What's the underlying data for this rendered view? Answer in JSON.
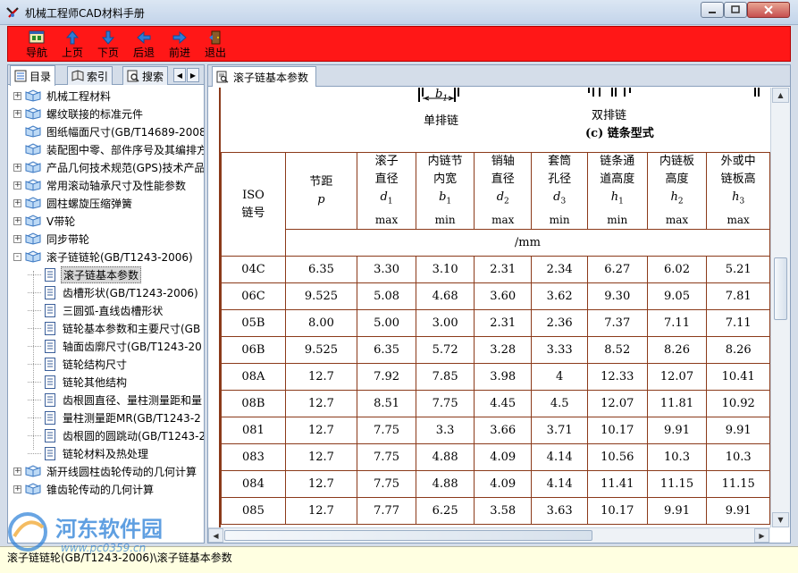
{
  "window": {
    "title": "机械工程师CAD材料手册"
  },
  "toolbar": {
    "buttons": [
      {
        "label": "导航",
        "icon": "navigate-icon"
      },
      {
        "label": "上页",
        "icon": "arrow-up-icon"
      },
      {
        "label": "下页",
        "icon": "arrow-down-icon"
      },
      {
        "label": "后退",
        "icon": "arrow-left-icon"
      },
      {
        "label": "前进",
        "icon": "arrow-right-icon"
      },
      {
        "label": "退出",
        "icon": "exit-door-icon"
      }
    ]
  },
  "left_tabs": [
    "目录",
    "索引",
    "搜索"
  ],
  "tree": [
    {
      "label": "机械工程材料",
      "level": 0,
      "type": "book",
      "expander": "+"
    },
    {
      "label": "螺纹联接的标准元件",
      "level": 0,
      "type": "book",
      "expander": "+"
    },
    {
      "label": "图纸幅面尺寸(GB/T14689-2008",
      "level": 0,
      "type": "book",
      "expander": ""
    },
    {
      "label": "装配图中零、部件序号及其编排方",
      "level": 0,
      "type": "book",
      "expander": ""
    },
    {
      "label": "产品几何技术规范(GPS)技术产品",
      "level": 0,
      "type": "book",
      "expander": "+"
    },
    {
      "label": "常用滚动轴承尺寸及性能参数",
      "level": 0,
      "type": "book",
      "expander": "+"
    },
    {
      "label": "圆柱螺旋压缩弹簧",
      "level": 0,
      "type": "book",
      "expander": "+"
    },
    {
      "label": "V带轮",
      "level": 0,
      "type": "book",
      "expander": "+"
    },
    {
      "label": "同步带轮",
      "level": 0,
      "type": "book",
      "expander": "+"
    },
    {
      "label": "滚子链链轮(GB/T1243-2006)",
      "level": 0,
      "type": "book",
      "expander": "-"
    },
    {
      "label": "滚子链基本参数",
      "level": 1,
      "type": "doc",
      "selected": true
    },
    {
      "label": "齿槽形状(GB/T1243-2006)",
      "level": 1,
      "type": "doc"
    },
    {
      "label": "三圆弧-直线齿槽形状",
      "level": 1,
      "type": "doc"
    },
    {
      "label": "链轮基本参数和主要尺寸(GB",
      "level": 1,
      "type": "doc"
    },
    {
      "label": "轴面齿廓尺寸(GB/T1243-20",
      "level": 1,
      "type": "doc"
    },
    {
      "label": "链轮结构尺寸",
      "level": 1,
      "type": "doc"
    },
    {
      "label": "链轮其他结构",
      "level": 1,
      "type": "doc"
    },
    {
      "label": "齿根圆直径、量柱测量距和量",
      "level": 1,
      "type": "doc"
    },
    {
      "label": "量柱测量距MR(GB/T1243-2",
      "level": 1,
      "type": "doc"
    },
    {
      "label": "齿根圆的圆跳动(GB/T1243-2",
      "level": 1,
      "type": "doc"
    },
    {
      "label": "链轮材料及热处理",
      "level": 1,
      "type": "doc"
    },
    {
      "label": "渐开线圆柱齿轮传动的几何计算",
      "level": 0,
      "type": "book",
      "expander": "+"
    },
    {
      "label": "锥齿轮传动的几何计算",
      "level": 0,
      "type": "book",
      "expander": "+"
    }
  ],
  "doc_tab": {
    "label": "滚子链基本参数"
  },
  "diagram": {
    "single_label": "单排链",
    "b1_label": "b",
    "b1_sub": "1",
    "double_label": "双排链",
    "caption": "(c) 链条型式"
  },
  "table": {
    "headers": [
      {
        "lines": [
          "ISO",
          "链号"
        ]
      },
      {
        "lines": [
          "节距"
        ],
        "sym": "p",
        "sub": "",
        "bound": ""
      },
      {
        "lines": [
          "滚子",
          "直径"
        ],
        "sym": "d",
        "sub": "1",
        "bound": "max"
      },
      {
        "lines": [
          "内链节",
          "内宽"
        ],
        "sym": "b",
        "sub": "1",
        "bound": "min"
      },
      {
        "lines": [
          "销轴",
          "直径"
        ],
        "sym": "d",
        "sub": "2",
        "bound": "max"
      },
      {
        "lines": [
          "套筒",
          "孔径"
        ],
        "sym": "d",
        "sub": "3",
        "bound": "min"
      },
      {
        "lines": [
          "链条通",
          "道高度"
        ],
        "sym": "h",
        "sub": "1",
        "bound": "min"
      },
      {
        "lines": [
          "内链板",
          "高度"
        ],
        "sym": "h",
        "sub": "2",
        "bound": "max"
      },
      {
        "lines": [
          "外或中",
          "链板高"
        ],
        "sym": "h",
        "sub": "3",
        "bound": "max"
      }
    ],
    "unit": "/mm",
    "rows": [
      [
        "04C",
        "6.35",
        "3.30",
        "3.10",
        "2.31",
        "2.34",
        "6.27",
        "6.02",
        "5.21"
      ],
      [
        "06C",
        "9.525",
        "5.08",
        "4.68",
        "3.60",
        "3.62",
        "9.30",
        "9.05",
        "7.81"
      ],
      [
        "05B",
        "8.00",
        "5.00",
        "3.00",
        "2.31",
        "2.36",
        "7.37",
        "7.11",
        "7.11"
      ],
      [
        "06B",
        "9.525",
        "6.35",
        "5.72",
        "3.28",
        "3.33",
        "8.52",
        "8.26",
        "8.26"
      ],
      [
        "08A",
        "12.7",
        "7.92",
        "7.85",
        "3.98",
        "4",
        "12.33",
        "12.07",
        "10.41"
      ],
      [
        "08B",
        "12.7",
        "8.51",
        "7.75",
        "4.45",
        "4.5",
        "12.07",
        "11.81",
        "10.92"
      ],
      [
        "081",
        "12.7",
        "7.75",
        "3.3",
        "3.66",
        "3.71",
        "10.17",
        "9.91",
        "9.91"
      ],
      [
        "083",
        "12.7",
        "7.75",
        "4.88",
        "4.09",
        "4.14",
        "10.56",
        "10.3",
        "10.3"
      ],
      [
        "084",
        "12.7",
        "7.75",
        "4.88",
        "4.09",
        "4.14",
        "11.41",
        "11.15",
        "11.15"
      ],
      [
        "085",
        "12.7",
        "7.77",
        "6.25",
        "3.58",
        "3.63",
        "10.17",
        "9.91",
        "9.91"
      ]
    ]
  },
  "status": {
    "text": "滚子链链轮(GB/T1243-2006)\\滚子链基本参数"
  },
  "watermark": {
    "text": "河东软件园",
    "url": "www.pc0359.cn"
  },
  "colors": {
    "toolbar": "#ff1717",
    "table_border": "#8b3a1a",
    "status_bg": "#ffffe1"
  }
}
